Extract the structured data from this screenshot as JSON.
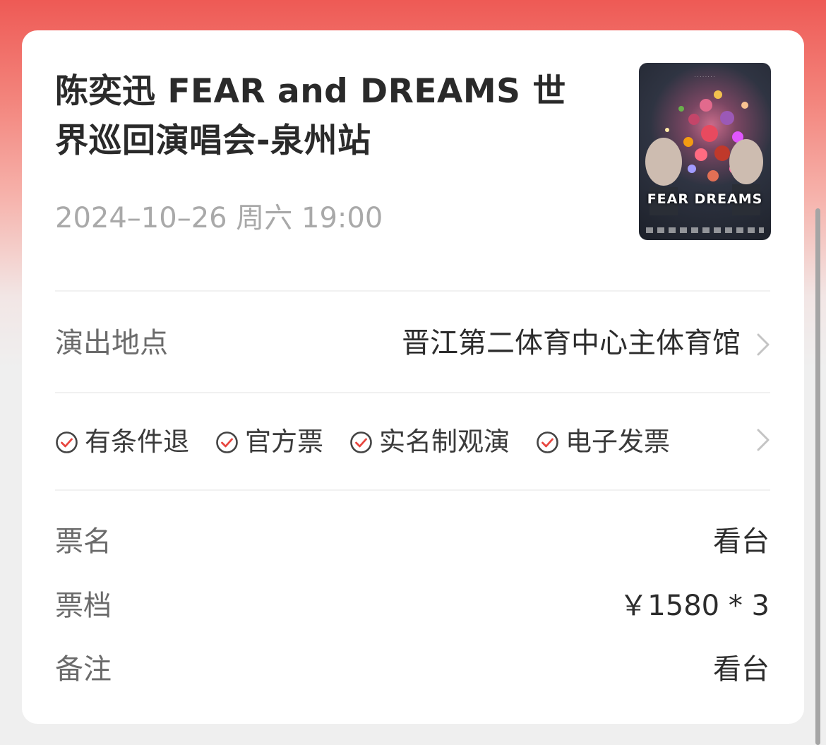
{
  "event": {
    "title": "陈奕迅 FEAR and DREAMS 世界巡回演唱会-泉州站",
    "datetime": "2024–10–26 周六 19:00",
    "poster_icon": "concert-poster-image",
    "poster_brand": "FEAR DREAMS"
  },
  "venue": {
    "label": "演出地点",
    "value": "晋江第二体育中心主体育馆",
    "icon": "chevron-right-icon"
  },
  "tags": [
    {
      "label": "有条件退",
      "icon": "check-circle-icon"
    },
    {
      "label": "官方票",
      "icon": "check-circle-icon"
    },
    {
      "label": "实名制观演",
      "icon": "check-circle-icon"
    },
    {
      "label": "电子发票",
      "icon": "check-circle-icon"
    }
  ],
  "ticket": {
    "name_label": "票名",
    "name_value": "看台",
    "price_label": "票档",
    "price_value": "￥1580 * 3",
    "note_label": "备注",
    "note_value": "看台"
  },
  "colors": {
    "accent": "#e8463f",
    "header_gradient_top": "#ee5a55",
    "background": "#efefef",
    "card": "#ffffff",
    "muted_text": "#a9a9a9"
  }
}
